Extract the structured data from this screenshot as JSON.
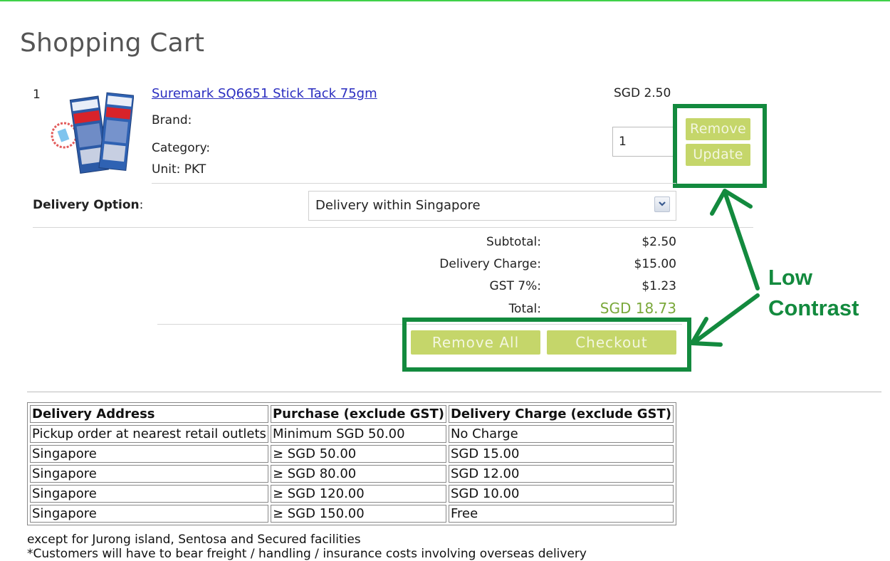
{
  "page_title": "Shopping Cart",
  "cart": {
    "item": {
      "number": "1",
      "name": "Suremark SQ6651 Stick Tack 75gm",
      "brand_label": "Brand:",
      "category_label": "Category:",
      "unit_label": "Unit: PKT",
      "price": "SGD 2.50",
      "quantity": "1"
    },
    "buttons": {
      "remove": "Remove",
      "update": "Update"
    }
  },
  "delivery": {
    "label": "Delivery Option",
    "colon": ":",
    "selected": "Delivery within Singapore"
  },
  "summary": {
    "subtotal_label": "Subtotal:",
    "subtotal": "$2.50",
    "delivery_label": "Delivery Charge:",
    "delivery": "$15.00",
    "gst_label": "GST 7%:",
    "gst": "$1.23",
    "total_label": "Total:",
    "total": "SGD 18.73"
  },
  "actions": {
    "remove_all": "Remove All",
    "checkout": "Checkout"
  },
  "annotation": {
    "line1": "Low",
    "line2": "Contrast"
  },
  "rates_table": {
    "headers": [
      "Delivery Address",
      "Purchase (exclude GST)",
      "Delivery Charge (exclude GST)"
    ],
    "rows": [
      [
        "Pickup order at nearest retail outlets",
        "Minimum SGD 50.00",
        "No Charge"
      ],
      [
        "Singapore",
        "≥ SGD 50.00",
        "SGD 15.00"
      ],
      [
        "Singapore",
        "≥ SGD 80.00",
        "SGD 12.00"
      ],
      [
        "Singapore",
        "≥ SGD 120.00",
        "SGD 10.00"
      ],
      [
        "Singapore",
        "≥ SGD 150.00",
        "Free"
      ]
    ]
  },
  "footnotes": {
    "line1": "except for Jurong island, Sentosa and Secured facilities",
    "line2": "*Customers will have to bear freight / handling / insurance costs involving overseas delivery"
  },
  "colors": {
    "button_bg": "#c5d66a",
    "button_text": "#f3f6df",
    "annotation": "#138a3e",
    "total": "#7aa83a",
    "link": "#2b2ec0"
  }
}
